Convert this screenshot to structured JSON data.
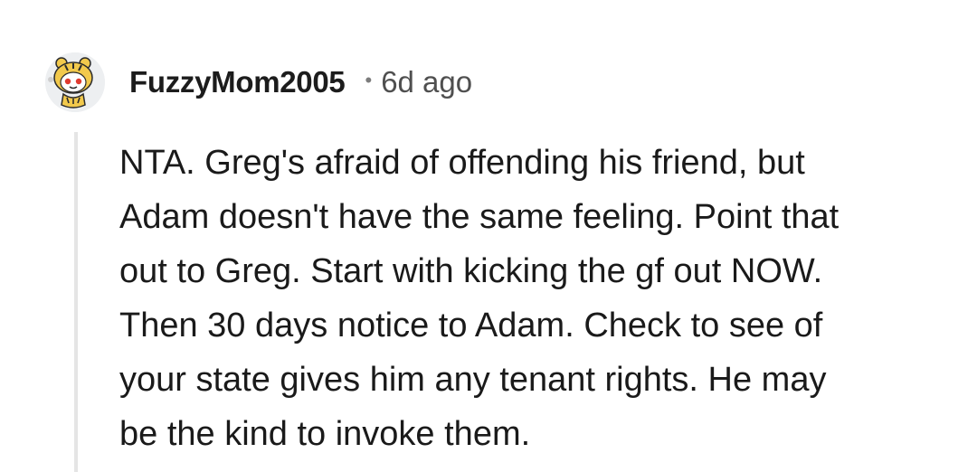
{
  "comment": {
    "username": "FuzzyMom2005",
    "separator": "•",
    "age": "6d ago",
    "lines": [
      "NTA.  Greg's afraid of offending his friend,  but",
      "Adam doesn't have the same feeling. Point that",
      "out to Greg. Start with kicking the gf out NOW.",
      "Then 30 days notice to Adam. Check to see of",
      "your state gives him any tenant rights. He may",
      "be the kind to invoke them."
    ],
    "avatar_icon": "snoo-tiger-avatar-icon"
  },
  "colors": {
    "thread_line": "#e5e5e5",
    "meta_text": "#4f4f4f",
    "avatar_bg": "#edeff1",
    "avatar_accent": "#f2c94c"
  }
}
